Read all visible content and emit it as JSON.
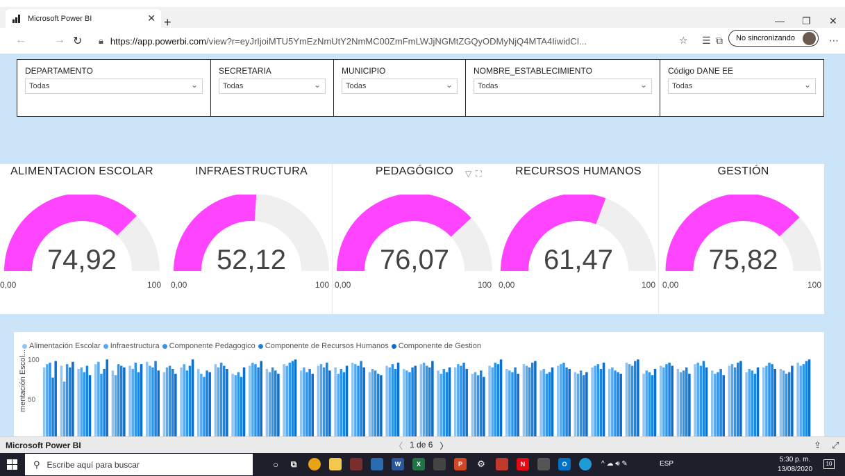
{
  "browser": {
    "tab_title": "Microsoft Power BI",
    "url_host": "https://app.powerbi.com",
    "url_rest": "/view?r=eyJrIjoiMTU5YmEzNmUtY2NmMC00ZmFmLWJjNGMtZGQyODMyNjQ4MTA4IiwidCI...",
    "sync_label": "No sincronizando"
  },
  "slicers": [
    {
      "label": "DEPARTAMENTO",
      "value": "Todas"
    },
    {
      "label": "SECRETARIA",
      "value": "Todas"
    },
    {
      "label": "MUNICIPIO",
      "value": "Todas"
    },
    {
      "label": "NOMBRE_ESTABLECIMIENTO",
      "value": "Todas"
    },
    {
      "label": "Código DANE EE",
      "value": "Todas"
    }
  ],
  "gauges": [
    {
      "title": "ALIMENTACION ESCOLAR",
      "value": "74,92",
      "fraction": 0.7492,
      "min": "0,00",
      "max": "100"
    },
    {
      "title": "INFRAESTRUCTURA",
      "value": "52,12",
      "fraction": 0.5212,
      "min": "0,00",
      "max": "100"
    },
    {
      "title": "PEDAGÓGICO",
      "value": "76,07",
      "fraction": 0.7607,
      "min": "0,00",
      "max": "100"
    },
    {
      "title": "RECURSOS HUMANOS",
      "value": "61,47",
      "fraction": 0.6147,
      "min": "0,00",
      "max": "100"
    },
    {
      "title": "GESTIÓN",
      "value": "75,82",
      "fraction": 0.7582,
      "min": "0,00",
      "max": "100"
    }
  ],
  "colors": {
    "gauge_fill": "#ff44ff",
    "gauge_track": "#f0efef",
    "canvas_bg": "#cce4f7"
  },
  "chart_data": {
    "type": "bar",
    "ylabel": "Alimentación Escol...",
    "ylabel_visible": "mentación Escol...",
    "y_ticks": [
      "100",
      "50"
    ],
    "series": [
      {
        "name": "Alimentación Escolar",
        "color": "#8fc4f3"
      },
      {
        "name": "Infraestructura",
        "color": "#56a9ef"
      },
      {
        "name": "Componente Pedagogico",
        "color": "#2e95ec"
      },
      {
        "name": "Componente de Recursos Humanos",
        "color": "#1b83e0"
      },
      {
        "name": "Componente de Gestion",
        "color": "#0a6fd0"
      }
    ],
    "values": [
      [
        88,
        92,
        94,
        75,
        96
      ],
      [
        90,
        70,
        92,
        88,
        95
      ],
      [
        86,
        88,
        82,
        90,
        78
      ],
      [
        92,
        95,
        80,
        86,
        98
      ],
      [
        84,
        78,
        92,
        90,
        88
      ],
      [
        90,
        86,
        94,
        82,
        92
      ],
      [
        95,
        90,
        88,
        96,
        84
      ],
      [
        82,
        88,
        90,
        86,
        80
      ],
      [
        88,
        92,
        84,
        90,
        98
      ],
      [
        86,
        80,
        76,
        84,
        82
      ],
      [
        92,
        88,
        94,
        90,
        86
      ],
      [
        80,
        78,
        82,
        76,
        88
      ],
      [
        90,
        94,
        92,
        88,
        96
      ],
      [
        86,
        82,
        88,
        84,
        80
      ],
      [
        92,
        90,
        94,
        96,
        98
      ],
      [
        84,
        88,
        82,
        86,
        80
      ],
      [
        90,
        92,
        88,
        94,
        84
      ],
      [
        88,
        80,
        86,
        82,
        90
      ],
      [
        94,
        92,
        90,
        96,
        88
      ],
      [
        82,
        86,
        84,
        80,
        78
      ],
      [
        90,
        88,
        92,
        86,
        94
      ],
      [
        86,
        84,
        82,
        88,
        90
      ],
      [
        92,
        94,
        90,
        88,
        96
      ],
      [
        84,
        80,
        86,
        82,
        88
      ],
      [
        88,
        92,
        90,
        94,
        86
      ],
      [
        80,
        82,
        78,
        84,
        76
      ],
      [
        90,
        88,
        94,
        92,
        98
      ],
      [
        86,
        84,
        82,
        88,
        80
      ],
      [
        92,
        90,
        88,
        94,
        96
      ],
      [
        84,
        86,
        80,
        82,
        88
      ],
      [
        90,
        92,
        94,
        88,
        86
      ],
      [
        82,
        80,
        84,
        78,
        82
      ],
      [
        88,
        90,
        92,
        86,
        94
      ],
      [
        86,
        88,
        84,
        82,
        80
      ],
      [
        94,
        92,
        90,
        96,
        98
      ],
      [
        80,
        84,
        82,
        78,
        86
      ],
      [
        90,
        88,
        92,
        94,
        90
      ],
      [
        86,
        82,
        84,
        88,
        80
      ],
      [
        92,
        94,
        90,
        96,
        88
      ],
      [
        84,
        80,
        82,
        86,
        78
      ],
      [
        90,
        92,
        88,
        94,
        96
      ],
      [
        82,
        86,
        84,
        80,
        88
      ],
      [
        88,
        90,
        94,
        92,
        86
      ],
      [
        86,
        84,
        80,
        82,
        90
      ],
      [
        94,
        90,
        92,
        96,
        98
      ]
    ]
  },
  "bottom": {
    "brand": "Microsoft Power BI",
    "page_indicator": "1 de 6"
  },
  "taskbar": {
    "search_placeholder": "Escribe aquí para buscar",
    "lang": "ESP",
    "time": "5:30 p. m.",
    "date": "13/08/2020",
    "notif_count": "10"
  }
}
